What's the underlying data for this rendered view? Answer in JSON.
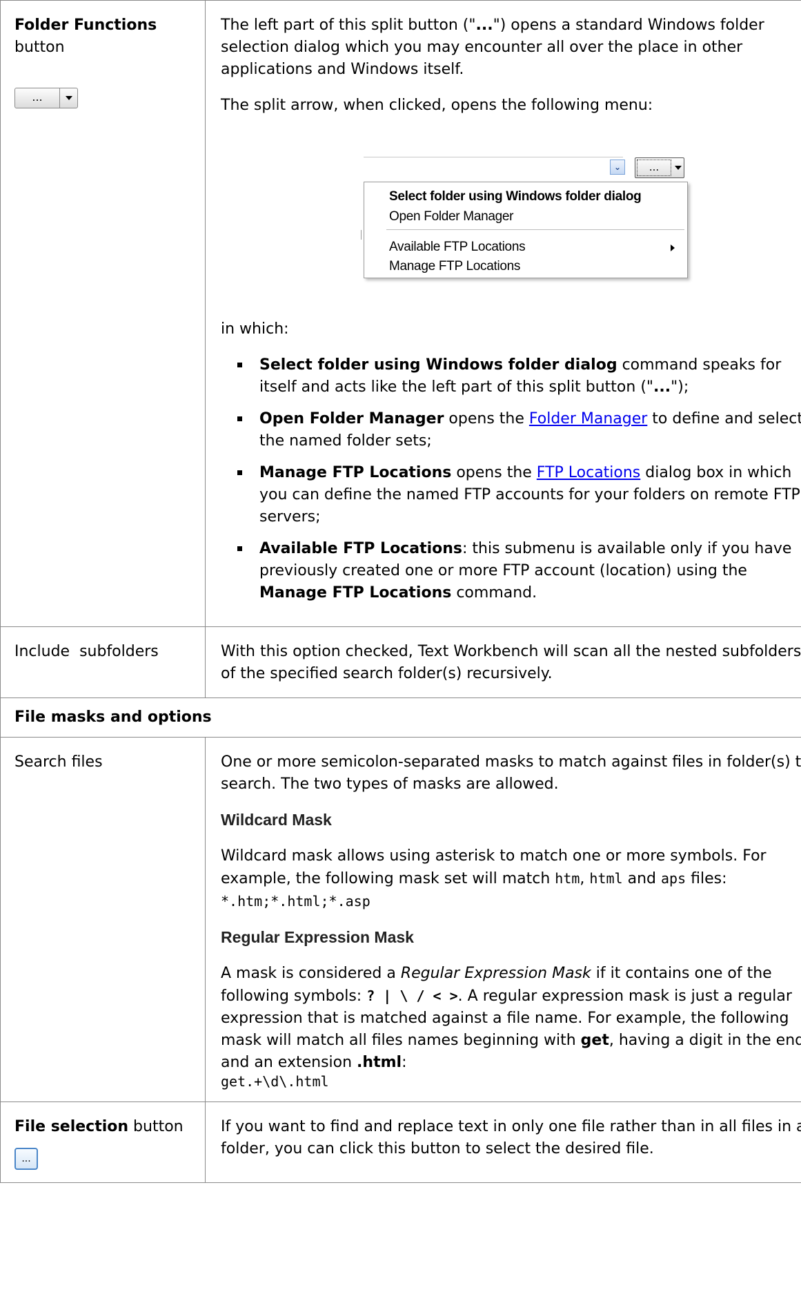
{
  "row1": {
    "left_bold": "Folder Functions",
    "left_rest": "button",
    "icon_btn_label": "...",
    "p1_a": "The left part of this split button (\"",
    "p1_b": "...",
    "p1_c": "\") opens a standard Windows folder selection dialog which you may encounter all over the place in other applications and Windows itself.",
    "p2": "The split arrow, when clicked, opens the following menu:",
    "menu": {
      "button_label": "...",
      "items": [
        "Select folder using Windows folder dialog",
        "Open Folder Manager",
        "Available FTP Locations",
        "Manage FTP Locations"
      ]
    },
    "in_which": "in which:",
    "bullets": [
      {
        "bold": "Select folder using Windows folder dialog",
        "t1": " command speaks for itself and acts like the left part of this split button (\"",
        "b2": "...",
        "t2": "\");"
      },
      {
        "bold": "Open Folder Manager",
        "t1": " opens the ",
        "link": "Folder Manager",
        "t2": " to define and select the named folder sets;"
      },
      {
        "bold": "Manage FTP Locations",
        "t1": " opens the ",
        "link": "FTP Locations",
        "t2": " dialog box in which you can define the named FTP accounts for your folders on remote FTP servers;"
      },
      {
        "bold": "Available FTP Locations",
        "t1": ": this submenu is available only if you have previously created one or more FTP account (location) using the ",
        "b2": "Manage FTP Locations",
        "t2": " command."
      }
    ]
  },
  "row2": {
    "left": "Include  subfolders",
    "right": "With this option checked, Text Workbench will scan all the nested subfolders of the specified search folder(s) recursively."
  },
  "section": "File masks and options",
  "row3": {
    "left": "Search files",
    "p1": "One or more semicolon-separated masks to match against files in folder(s) to search. The two types of masks are allowed.",
    "h1": "Wildcard Mask",
    "p2_a": "Wildcard mask allows using asterisk to match one or more symbols. For example, the following mask set will match ",
    "c1": "htm",
    "p2_b": ", ",
    "c2": "html",
    "p2_c": " and ",
    "c3": "aps",
    "p2_d": " files: ",
    "c4": "*.htm;*.html;*.asp",
    "h2": "Regular Expression Mask",
    "p3_a": "A mask is considered a ",
    "p3_i": "Regular Expression Mask",
    "p3_b": " if it contains one of the following symbols: ",
    "symbols": "? | \\ / < >",
    "p3_c": ". A regular expression mask is just a regular expression that is matched against a file name. For example, the following mask will match all files names beginning with ",
    "p3_get": "get",
    "p3_d": ", having a digit in the end and an extension ",
    "p3_ext": ".html",
    "p3_e": ":",
    "code": "get.+\\d\\.html"
  },
  "row4": {
    "left_bold": "File selection",
    "left_rest": " button",
    "icon_btn_label": "...",
    "right": "If you want to find and replace text in only one file rather than in all files in a folder, you can click this button to select the desired file."
  }
}
